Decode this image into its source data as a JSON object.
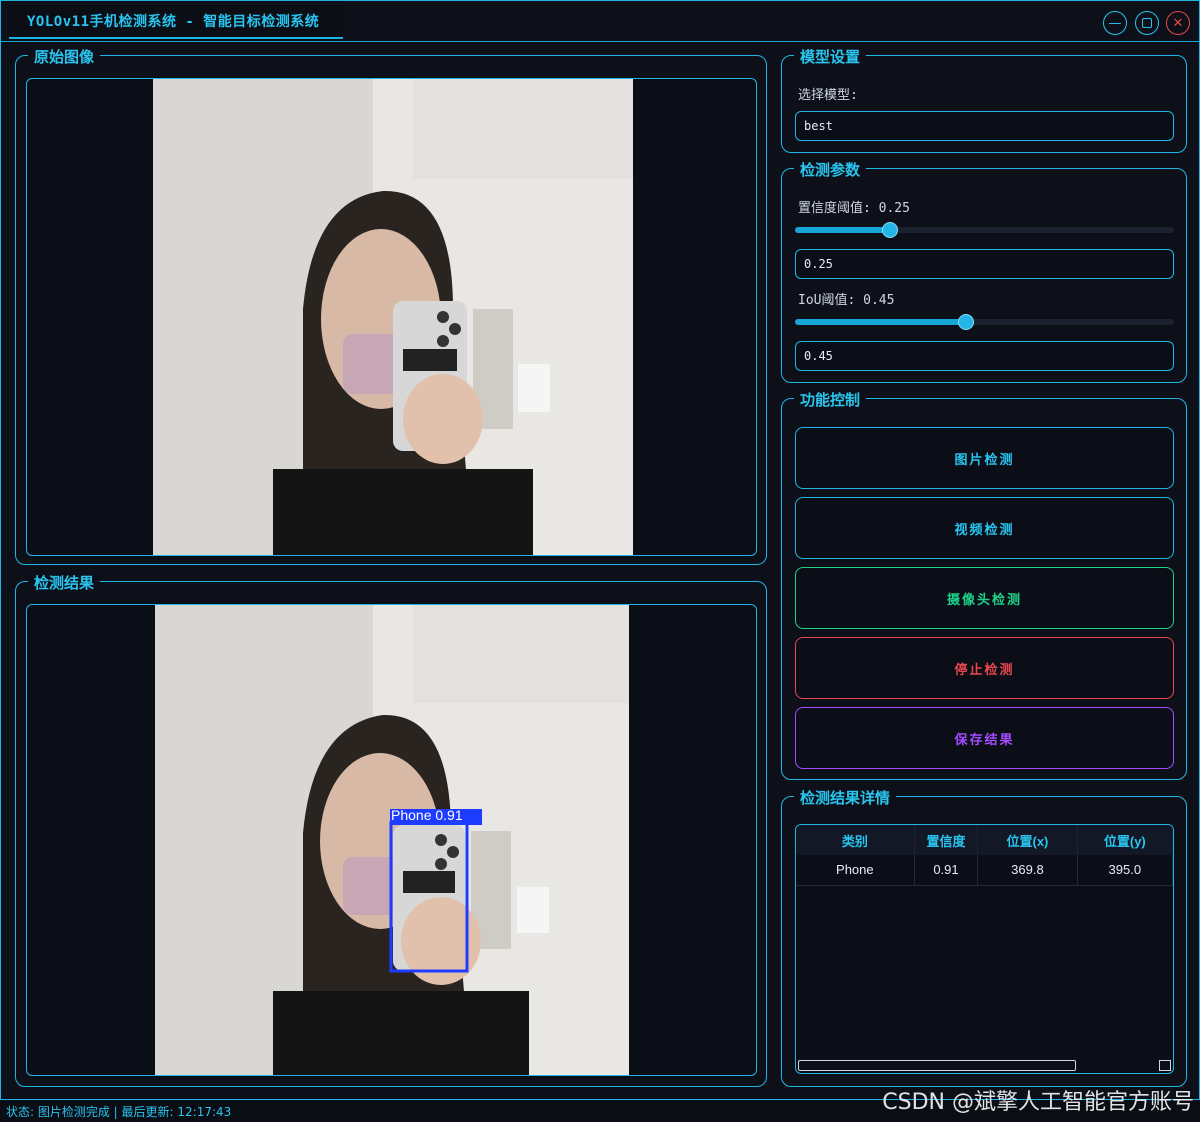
{
  "window": {
    "title": "YOLOv11手机检测系统 - 智能目标检测系统"
  },
  "panels": {
    "original_title": "原始图像",
    "result_title": "检测结果"
  },
  "detection_overlay": {
    "label": "Phone 0.91"
  },
  "model": {
    "title": "模型设置",
    "select_label": "选择模型:",
    "selected": "best"
  },
  "params": {
    "title": "检测参数",
    "conf_label": "置信度阈值: 0.25",
    "conf_value": "0.25",
    "conf_fraction": 0.25,
    "iou_label": "IoU阈值: 0.45",
    "iou_value": "0.45",
    "iou_fraction": 0.45
  },
  "controls": {
    "title": "功能控制",
    "image_detect": "图片检测",
    "video_detect": "视频检测",
    "camera_detect": "摄像头检测",
    "stop_detect": "停止检测",
    "save_result": "保存结果"
  },
  "details": {
    "title": "检测结果详情",
    "columns": [
      "类别",
      "置信度",
      "位置(x)",
      "位置(y)"
    ],
    "rows": [
      [
        "Phone",
        "0.91",
        "369.8",
        "395.0"
      ]
    ]
  },
  "status": {
    "text": "状态: 图片检测完成 | 最后更新: 12:17:43"
  },
  "watermark": "CSDN @斌擎人工智能官方账号",
  "colors": {
    "accent": "#1fb6e6",
    "stop": "#e5484d",
    "camera": "#1fd18a",
    "save": "#a24bff",
    "bbox": "#1e3cff"
  }
}
